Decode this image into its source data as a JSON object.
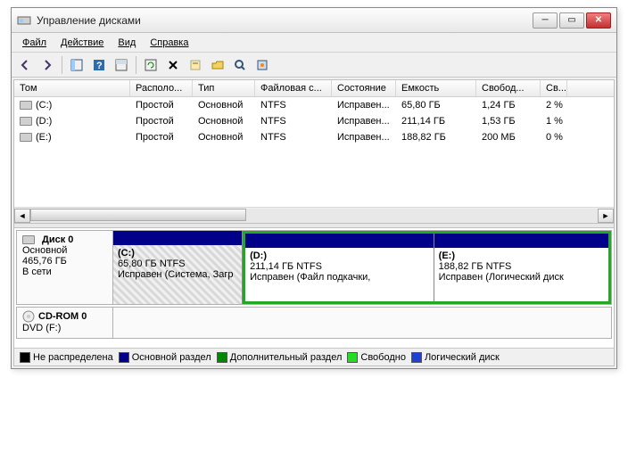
{
  "window": {
    "title": "Управление дисками"
  },
  "menu": {
    "file": "Файл",
    "action": "Действие",
    "view": "Вид",
    "help": "Справка"
  },
  "columns": [
    "Том",
    "Располо...",
    "Тип",
    "Файловая с...",
    "Состояние",
    "Емкость",
    "Свобод...",
    "Св..."
  ],
  "volumes": [
    {
      "name": "(C:)",
      "layout": "Простой",
      "type": "Основной",
      "fs": "NTFS",
      "status": "Исправен...",
      "cap": "65,80 ГБ",
      "free": "1,24 ГБ",
      "pct": "2 %"
    },
    {
      "name": "(D:)",
      "layout": "Простой",
      "type": "Основной",
      "fs": "NTFS",
      "status": "Исправен...",
      "cap": "211,14 ГБ",
      "free": "1,53 ГБ",
      "pct": "1 %"
    },
    {
      "name": "(E:)",
      "layout": "Простой",
      "type": "Основной",
      "fs": "NTFS",
      "status": "Исправен...",
      "cap": "188,82 ГБ",
      "free": "200 МБ",
      "pct": "0 %"
    }
  ],
  "disk0": {
    "title": "Диск 0",
    "type": "Основной",
    "cap": "465,76 ГБ",
    "state": "В сети",
    "parts": [
      {
        "name": "(C:)",
        "line2": "65,80 ГБ NTFS",
        "line3": "Исправен (Система, Загр"
      },
      {
        "name": "(D:)",
        "line2": "211,14 ГБ NTFS",
        "line3": "Исправен (Файл подкачки,"
      },
      {
        "name": "(E:)",
        "line2": "188,82 ГБ NTFS",
        "line3": "Исправен (Логический диск"
      }
    ]
  },
  "cdrom": {
    "title": "CD-ROM 0",
    "sub": "DVD (F:)"
  },
  "legend": {
    "unalloc": "Не распределена",
    "primary": "Основной раздел",
    "extended": "Дополнительный раздел",
    "free": "Свободно",
    "logical": "Логический диск"
  },
  "colors": {
    "unalloc": "#000000",
    "primary": "#000088",
    "extended": "#008800",
    "free": "#22dd22",
    "logical": "#2040d0"
  }
}
